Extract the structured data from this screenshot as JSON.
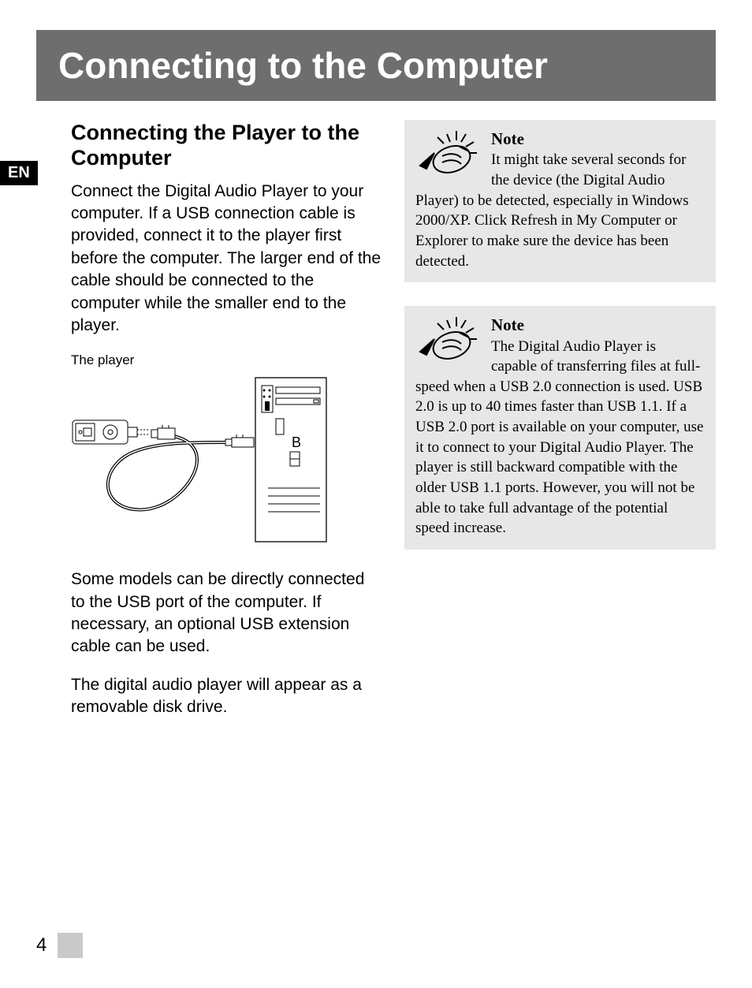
{
  "lang_badge": "EN",
  "header_title": "Connecting to the Computer",
  "left": {
    "subheading": "Connecting the Player to the Computer",
    "para1": "Connect the Digital Audio Player to your computer. If a USB connection cable is provided, connect it to the player first before the computer. The larger end of the cable should be connected to the computer while the smaller end to the player.",
    "caption": "The player",
    "para2": "Some models can be directly connected to the USB port of the computer. If necessary, an optional USB extension cable can be used.",
    "para3": "The digital audio player will appear as a removable disk drive."
  },
  "notes": {
    "note1_heading": "Note",
    "note1_body": "It might take several seconds for the device (the Digital Audio Player) to be detected, especially in Windows 2000/XP. Click Refresh in My Computer or Explorer to make sure the device has been detected.",
    "note2_heading": "Note",
    "note2_body": "The Digital Audio Player is capable of transferring files at full-speed when a USB 2.0 connection is used. USB 2.0 is up to 40 times faster than USB 1.1. If a USB 2.0 port is available on your computer, use it to connect to your Digital Audio Player. The player is still backward compatible with the older USB 1.1 ports. However, you will not be able to take full advantage of the potential speed increase."
  },
  "page_number": "4"
}
